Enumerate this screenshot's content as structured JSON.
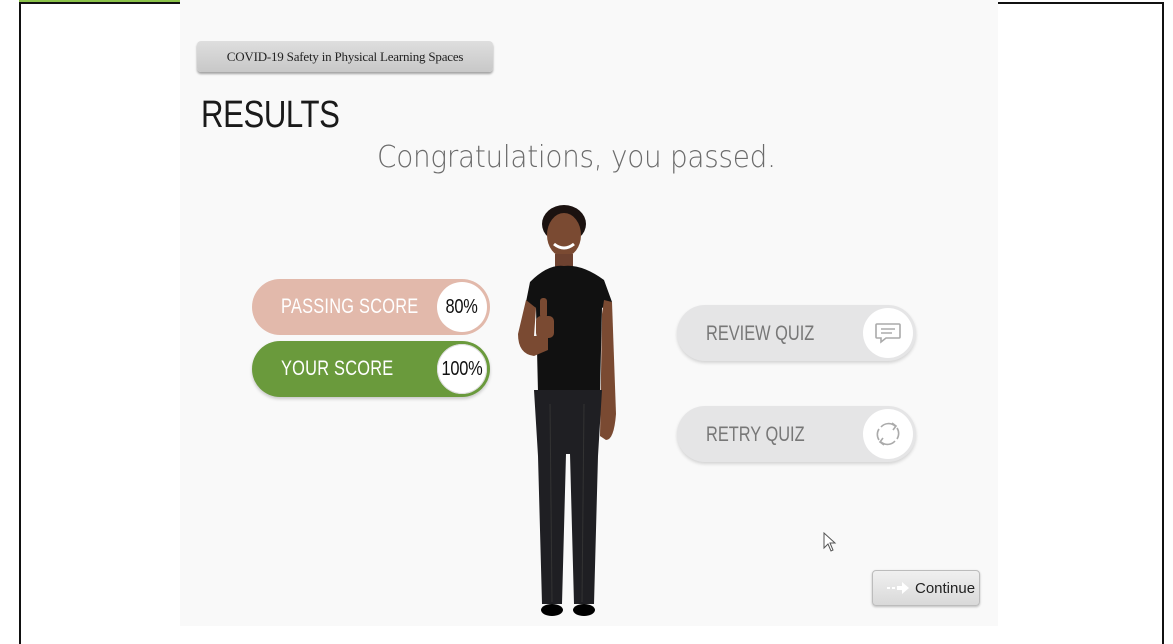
{
  "course": {
    "title": "COVID-19 Safety in Physical Learning Spaces"
  },
  "results": {
    "heading": "RESULTS",
    "message": "Congratulations, you passed."
  },
  "scores": {
    "passing_label": "PASSING SCORE",
    "passing_value": "80%",
    "your_label": "YOUR SCORE",
    "your_value": "100%"
  },
  "actions": {
    "review_label": "REVIEW QUIZ",
    "review_icon": "chat-bubble-icon",
    "retry_label": "RETRY QUIZ",
    "retry_icon": "refresh-icon"
  },
  "navigation": {
    "continue_label": "Continue",
    "continue_icon": "arrow-right-icon"
  },
  "colors": {
    "passing_pill": "#e2b9ab",
    "your_score_pill": "#6a9a3c",
    "action_pill": "#e5e5e6",
    "accent_strip": "#8bc34a"
  }
}
